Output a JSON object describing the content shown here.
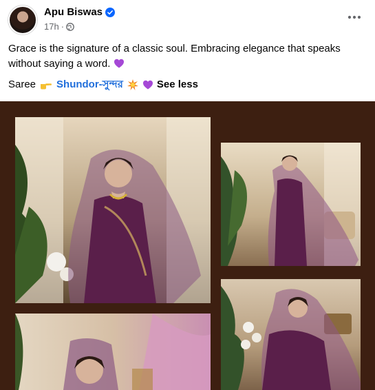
{
  "post": {
    "author": "Apu Biswas",
    "time": "17h",
    "separator": "·",
    "caption": "Grace is the signature of a classic soul. Embracing elegance that speaks without saying a word.",
    "tag_prefix": "Saree",
    "hashtag": "Shundor-সুন্দর",
    "see_less": "See less"
  },
  "icons": {
    "verified": "verified-badge-icon",
    "privacy": "globe-icon",
    "more": "more-options-icon",
    "pointing": "pointing-right-emoji",
    "heart": "purple-heart-emoji",
    "sparkle": "collision-emoji"
  },
  "colors": {
    "text": "#050505",
    "secondary": "#65676b",
    "hashtag": "#216fdb",
    "verified": "#0866ff",
    "gallery_bg": "#3d1f11",
    "saree": "#5a1f4a"
  },
  "gallery": {
    "photo_count": 4
  }
}
